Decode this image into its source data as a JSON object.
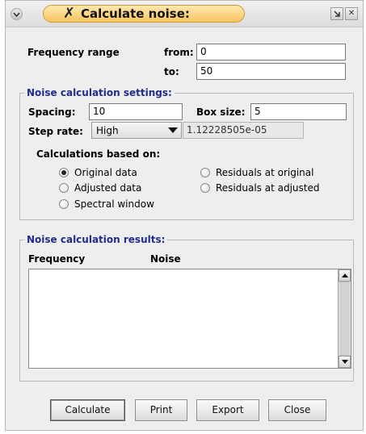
{
  "window": {
    "title": "Calculate noise:",
    "title_icon": "x-app-icon",
    "menu_icon": "chevron-down-icon",
    "minimize_icon": "corner-arrow-icon",
    "close_icon": "close-icon",
    "close_glyph": "✕"
  },
  "frequency_range": {
    "label": "Frequency range",
    "from_label": "from:",
    "from_value": "0",
    "to_label": "to:",
    "to_value": "50"
  },
  "settings": {
    "group_title": "Noise calculation settings:",
    "spacing_label": "Spacing:",
    "spacing_value": "10",
    "box_size_label": "Box size:",
    "box_size_value": "5",
    "step_rate_label": "Step rate:",
    "step_rate_selected": "High",
    "step_rate_value": "1.12228505e-05",
    "based_on_label": "Calculations based on:",
    "options": [
      {
        "label": "Original data",
        "checked": true
      },
      {
        "label": "Adjusted data",
        "checked": false
      },
      {
        "label": "Spectral window",
        "checked": false
      },
      {
        "label": "Residuals at original",
        "checked": false
      },
      {
        "label": "Residuals at adjusted",
        "checked": false
      }
    ]
  },
  "results": {
    "group_title": "Noise calculation results:",
    "columns": [
      "Frequency",
      "Noise"
    ],
    "rows": []
  },
  "buttons": {
    "calculate": "Calculate",
    "print": "Print",
    "export": "Export",
    "close": "Close"
  },
  "colors": {
    "group_title": "#1f2e8c",
    "title_pill": "#f8c45e",
    "window_bg": "#eeeeee"
  }
}
